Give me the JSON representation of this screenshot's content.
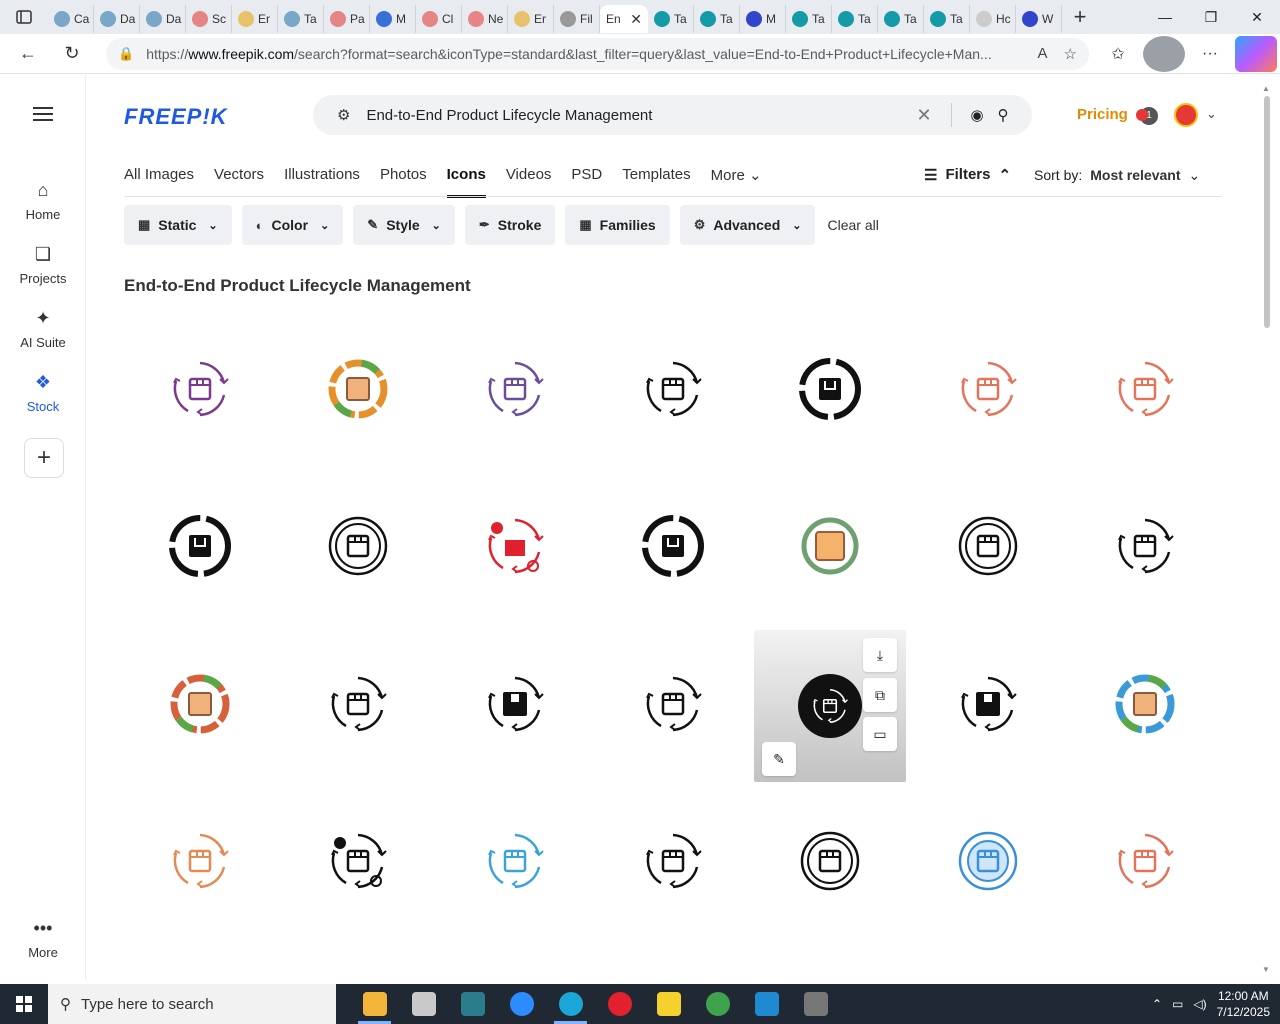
{
  "browser": {
    "tabs": [
      {
        "label": "Ca",
        "color": "#7aa7c7"
      },
      {
        "label": "Da",
        "color": "#7aa7c7"
      },
      {
        "label": "Da",
        "color": "#7aa7c7"
      },
      {
        "label": "Sc",
        "color": "#e58585"
      },
      {
        "label": "Er",
        "color": "#e8c26b"
      },
      {
        "label": "Ta",
        "color": "#7aa7c7"
      },
      {
        "label": "Pa",
        "color": "#e58585"
      },
      {
        "label": "M",
        "color": "#3b6fd8"
      },
      {
        "label": "Cl",
        "color": "#e58585"
      },
      {
        "label": "Ne",
        "color": "#e58585"
      },
      {
        "label": "Er",
        "color": "#e8c26b"
      },
      {
        "label": "Fil",
        "color": "#999999"
      }
    ],
    "active_tab": "En",
    "tabs_right": [
      {
        "label": "Ta",
        "color": "#159aa8"
      },
      {
        "label": "Ta",
        "color": "#159aa8"
      },
      {
        "label": "M",
        "color": "#3344cc"
      },
      {
        "label": "Ta",
        "color": "#159aa8"
      },
      {
        "label": "Ta",
        "color": "#159aa8"
      },
      {
        "label": "Ta",
        "color": "#159aa8"
      },
      {
        "label": "Ta",
        "color": "#159aa8"
      },
      {
        "label": "Hc",
        "color": "#cccccc"
      },
      {
        "label": "W",
        "color": "#3344cc"
      }
    ],
    "url_prefix": "https://",
    "url_domain": "www.freepik.com",
    "url_rest": "/search?format=search&iconType=standard&last_filter=query&last_value=End-to-End+Product+Lifecycle+Man..."
  },
  "rail": {
    "items": [
      {
        "label": "Home",
        "icon": "home-icon"
      },
      {
        "label": "Projects",
        "icon": "projects-icon"
      },
      {
        "label": "AI Suite",
        "icon": "sparkle-icon"
      },
      {
        "label": "Stock",
        "icon": "stock-icon"
      }
    ],
    "more": "More"
  },
  "header": {
    "logo": "FREEP!K",
    "search_value": "End-to-End Product Lifecycle Management",
    "pricing": "Pricing",
    "notification_count": "1"
  },
  "categories": [
    "All Images",
    "Vectors",
    "Illustrations",
    "Photos",
    "Icons",
    "Videos",
    "PSD",
    "Templates",
    "More"
  ],
  "active_category": "Icons",
  "filters_label": "Filters",
  "sort": {
    "label": "Sort by:",
    "value": "Most relevant"
  },
  "chips": [
    {
      "label": "Static",
      "icon": "static-icon",
      "dropdown": true
    },
    {
      "label": "Color",
      "icon": "palette-icon",
      "dropdown": true
    },
    {
      "label": "Style",
      "icon": "brush-icon",
      "dropdown": true
    },
    {
      "label": "Stroke",
      "icon": "pen-icon",
      "dropdown": false
    },
    {
      "label": "Families",
      "icon": "families-icon",
      "dropdown": false
    },
    {
      "label": "Advanced",
      "icon": "gear-icon",
      "dropdown": true
    }
  ],
  "clear_all": "Clear all",
  "result_title": "End-to-End Product Lifecycle Management",
  "icons": [
    {
      "style": "outline",
      "color": "#7a3b8f"
    },
    {
      "style": "multicolor",
      "color": "#e7902b"
    },
    {
      "style": "outline",
      "color": "#6b4e9b"
    },
    {
      "style": "outline",
      "color": "#111111"
    },
    {
      "style": "solid-ring",
      "color": "#111111"
    },
    {
      "style": "outline",
      "color": "#e57359"
    },
    {
      "style": "outline",
      "color": "#e57359"
    },
    {
      "style": "solid-ring",
      "color": "#111111"
    },
    {
      "style": "outline-ring",
      "color": "#111111"
    },
    {
      "style": "red-outline",
      "color": "#e0202d"
    },
    {
      "style": "solid-ring",
      "color": "#111111"
    },
    {
      "style": "flat",
      "color": "#c8766f"
    },
    {
      "style": "outline-ring",
      "color": "#111111"
    },
    {
      "style": "outline",
      "color": "#111111"
    },
    {
      "style": "multicolor",
      "color": "#d75f3a"
    },
    {
      "style": "outline",
      "color": "#111111"
    },
    {
      "style": "solid",
      "color": "#111111"
    },
    {
      "style": "outline",
      "color": "#111111"
    },
    {
      "style": "hovered",
      "color": "#111111"
    },
    {
      "style": "solid",
      "color": "#111111"
    },
    {
      "style": "multicolor",
      "color": "#3a9ad9"
    },
    {
      "style": "outline",
      "color": "#e58a52"
    },
    {
      "style": "solid-outline",
      "color": "#111111"
    },
    {
      "style": "outline",
      "color": "#3aa4d9"
    },
    {
      "style": "outline",
      "color": "#111111"
    },
    {
      "style": "outline-ring",
      "color": "#111111"
    },
    {
      "style": "blue-ring",
      "color": "#3a8fd9"
    },
    {
      "style": "outline",
      "color": "#e57359"
    }
  ],
  "hover_actions": [
    "download-icon",
    "copy-icon",
    "collection-icon",
    "edit-image-icon"
  ],
  "taskbar": {
    "search_placeholder": "Type here to search",
    "apps": [
      {
        "name": "file-explorer-icon",
        "color": "#f2b53a",
        "running": true
      },
      {
        "name": "photos-icon",
        "color": "#c9c9c9",
        "running": false
      },
      {
        "name": "app-icon",
        "color": "#2b7c8c",
        "running": false
      },
      {
        "name": "zoom-icon",
        "color": "#2d8cff",
        "running": false
      },
      {
        "name": "edge-icon",
        "color": "#1aa7d8",
        "running": true
      },
      {
        "name": "opera-icon",
        "color": "#e3202d",
        "running": false
      },
      {
        "name": "sticky-notes-icon",
        "color": "#f5d22b",
        "running": false
      },
      {
        "name": "chrome-icon",
        "color": "#3fa34d",
        "running": false
      },
      {
        "name": "vscode-icon",
        "color": "#1f8ad2",
        "running": false
      },
      {
        "name": "settings-icon",
        "color": "#777777",
        "running": false
      }
    ],
    "time": "12:00 AM",
    "date": "7/12/2025"
  }
}
